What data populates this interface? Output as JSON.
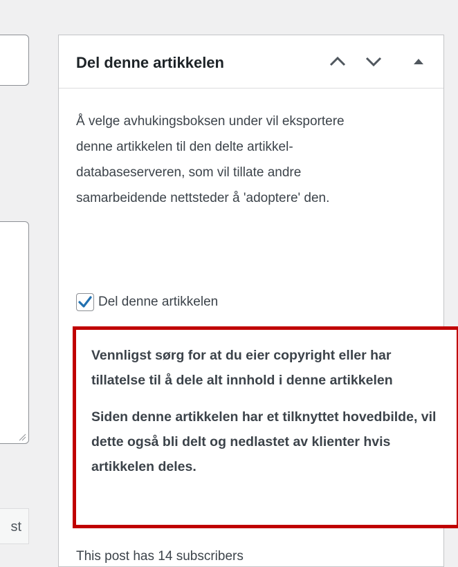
{
  "left": {
    "button_text": "st"
  },
  "metabox": {
    "title": "Del denne artikkelen",
    "move_up_icon": "chevron-up-icon",
    "move_down_icon": "chevron-down-icon",
    "toggle_icon": "triangle-up-icon",
    "description": "Å velge avhukingsboksen under vil eksportere denne artikkelen til den delte artikkel-databaseserveren, som vil tillate andre samarbeidende nettsteder å 'adoptere' den.",
    "checkbox": {
      "label": "Del denne artikkelen",
      "checked": true
    },
    "warning": {
      "border_color": "#c00000",
      "line1": "Vennligst sørg for at du eier copyright eller har tillatelse til å dele alt innhold i denne artikkelen",
      "line2": "Siden denne artikkelen har et tilknyttet hovedbilde, vil dette også bli delt og nedlastet av klienter hvis artikkelen deles."
    },
    "subscribers_text": "This post has 14 subscribers"
  },
  "colors": {
    "accent": "#2271b1",
    "background": "#f0f0f1"
  }
}
